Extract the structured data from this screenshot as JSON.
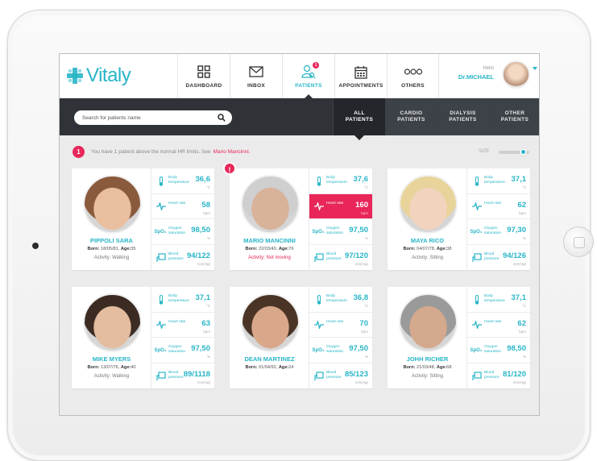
{
  "app": {
    "name": "Vitaly"
  },
  "nav": [
    {
      "label": "DASHBOARD",
      "icon": "dashboard-grid-icon",
      "active": false
    },
    {
      "label": "INBOX",
      "icon": "envelope-icon",
      "active": false
    },
    {
      "label": "PATIENTS",
      "icon": "patients-search-icon",
      "active": true,
      "badge": "1"
    },
    {
      "label": "APPOINTMENTS",
      "icon": "calendar-icon",
      "active": false
    },
    {
      "label": "OTHERS",
      "icon": "more-circles-icon",
      "active": false
    }
  ],
  "user": {
    "greeting": "Hello",
    "name": "Dr.MICHAEL"
  },
  "search": {
    "placeholder": "Search for patients name"
  },
  "tabs": [
    {
      "line1": "ALL",
      "line2": "PATIENTS",
      "active": true
    },
    {
      "line1": "CARDIO",
      "line2": "PATIENTS",
      "active": false
    },
    {
      "line1": "DIALYSIS",
      "line2": "PATIENTS",
      "active": false
    },
    {
      "line1": "OTHER",
      "line2": "PATIENTS",
      "active": false
    }
  ],
  "alert": {
    "count": "1",
    "text": "You have 1 patient above the normal HR limits. See",
    "link": "Mario Mancinni."
  },
  "size_control": {
    "label": "SIZE"
  },
  "metric_labels": {
    "temp": "Body temperature",
    "heart": "Heart rate",
    "oxygen": "Oxygen saturation",
    "pressure": "Blood pressure",
    "spo_icon": "SpO₂"
  },
  "units": {
    "temp": "°C",
    "heart": "bpm",
    "oxygen": "%",
    "pressure": "mm(Hg)"
  },
  "patients": [
    {
      "name": "PIPPOLI SARA",
      "born_label": "Born:",
      "born": "18/05/81,",
      "age_label": "Age:",
      "age": "35",
      "activity": "Activity: Walking",
      "alert": false,
      "temp": "36,6",
      "heart": "58",
      "oxygen": "98,50",
      "pressure": "94/122"
    },
    {
      "name": "MARIO MANCINNI",
      "born_label": "Born:",
      "born": "22/03/40,",
      "age_label": "Age:",
      "age": "76",
      "activity": "Activity: Not moving",
      "alert": true,
      "temp": "37,6",
      "heart": "160",
      "oxygen": "97,50",
      "pressure": "97/120"
    },
    {
      "name": "MAYA RICO",
      "born_label": "Born:",
      "born": "04/07/78,",
      "age_label": "Age:",
      "age": "38",
      "activity": "Activity: Sitting",
      "alert": false,
      "temp": "37,1",
      "heart": "62",
      "oxygen": "97,30",
      "pressure": "94/126"
    },
    {
      "name": "MIKE MYERS",
      "born_label": "Born:",
      "born": "13/07/76,",
      "age_label": "Age:",
      "age": "40",
      "activity": "Activity: Walking",
      "alert": false,
      "temp": "37,1",
      "heart": "63",
      "oxygen": "97,50",
      "pressure": "89/1118"
    },
    {
      "name": "DEAN MARTINEZ",
      "born_label": "Born:",
      "born": "01/04/92,",
      "age_label": "Age:",
      "age": "24",
      "activity": "",
      "alert": false,
      "temp": "36,8",
      "heart": "70",
      "oxygen": "97,50",
      "pressure": "85/123"
    },
    {
      "name": "JOHH RICHER",
      "born_label": "Born:",
      "born": "21/03/48,",
      "age_label": "Age:",
      "age": "68",
      "activity": "Activity: Sitting",
      "alert": false,
      "temp": "37,1",
      "heart": "62",
      "oxygen": "98,50",
      "pressure": "81/120"
    }
  ],
  "colors": {
    "accent": "#27b5c7",
    "alert": "#e8265a",
    "dark_bar": "#2f3338"
  }
}
